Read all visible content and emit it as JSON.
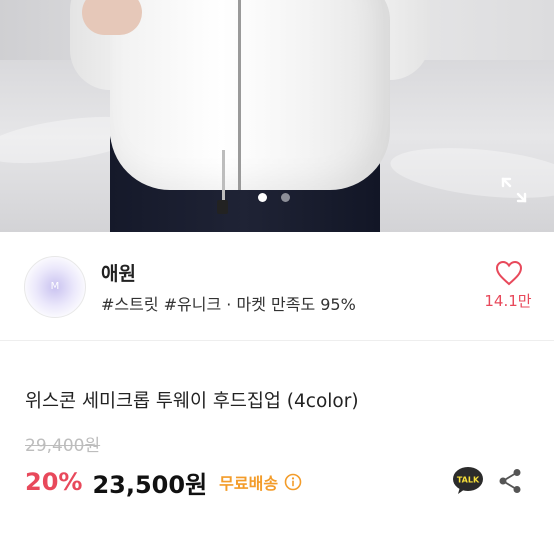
{
  "gallery": {
    "image_alt": "product-photo-white-hood-zipup",
    "dots": 2,
    "active_dot": 1,
    "expand_icon": "expand-icon"
  },
  "seller": {
    "name": "애원",
    "tags_line": "#스트릿 #유니크 · 마켓 만족도 95%",
    "likes": "14.1만",
    "heart_color": "#e8495b"
  },
  "product": {
    "title": "위스콘 세미크롭 투웨이 후드집업 (4color)",
    "original_price": "29,400원",
    "discount": "20%",
    "price": "23,500원",
    "shipping": "무료배송",
    "accent_color": "#e8495b",
    "shipping_color": "#f39c2a"
  },
  "actions": {
    "talk_label": "TALK",
    "share_icon": "share-icon"
  }
}
